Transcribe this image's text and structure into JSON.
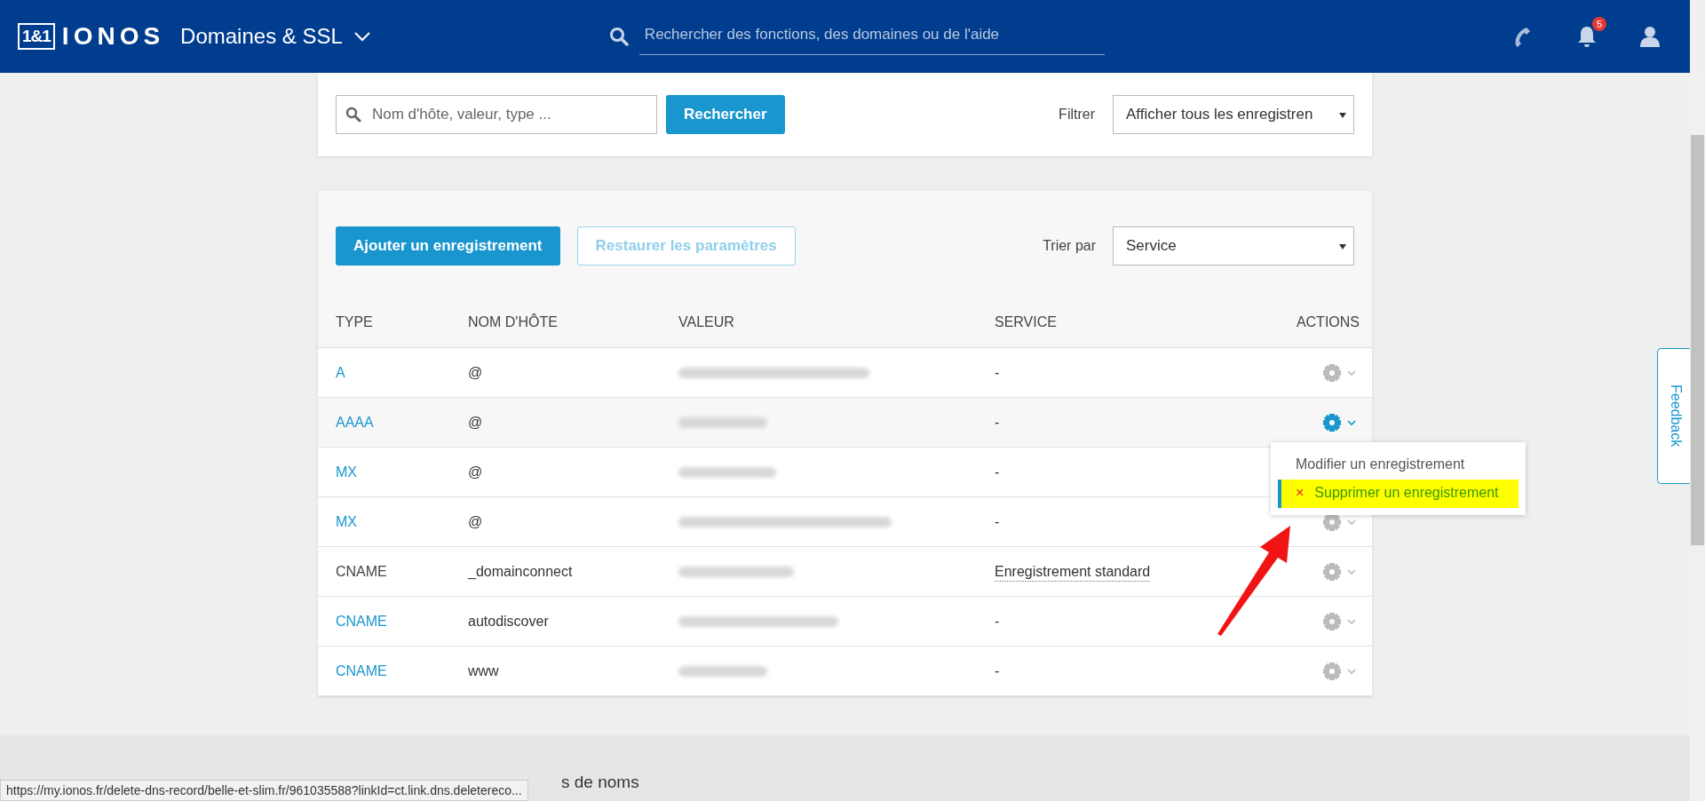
{
  "header": {
    "logo_box": "1&1",
    "logo_word": "IONOS",
    "section": "Domaines & SSL",
    "search": {
      "placeholder": "Rechercher des fonctions, des domaines ou de l'aide"
    },
    "notifications": "5"
  },
  "search_panel": {
    "search": {
      "placeholder": "Nom d'hôte, valeur, type ..."
    },
    "search_button": "Rechercher",
    "filter_label": "Filtrer",
    "filter_value": "Afficher tous les enregistren"
  },
  "records_panel": {
    "add_button": "Ajouter un enregistrement",
    "restore_button": "Restaurer les paramètres",
    "sort_label": "Trier par",
    "sort_value": "Service",
    "columns": [
      "TYPE",
      "NOM D'HÔTE",
      "VALEUR",
      "SERVICE",
      "ACTIONS"
    ],
    "rows": [
      {
        "type": "A",
        "link": true,
        "host": "@",
        "service": "-",
        "underlined": false,
        "active": false
      },
      {
        "type": "AAAA",
        "link": true,
        "host": "@",
        "service": "-",
        "underlined": false,
        "active": true
      },
      {
        "type": "MX",
        "link": true,
        "host": "@",
        "service": "-",
        "underlined": false,
        "active": false
      },
      {
        "type": "MX",
        "link": true,
        "host": "@",
        "service": "-",
        "underlined": false,
        "active": false
      },
      {
        "type": "CNAME",
        "link": false,
        "host": "_domainconnect",
        "service": "Enregistrement standard",
        "underlined": true,
        "active": false
      },
      {
        "type": "CNAME",
        "link": true,
        "host": "autodiscover",
        "service": "-",
        "underlined": false,
        "active": false
      },
      {
        "type": "CNAME",
        "link": true,
        "host": "www",
        "service": "-",
        "underlined": false,
        "active": false
      }
    ],
    "menu": [
      {
        "label": "Modifier un enregistrement",
        "kind": "edit",
        "highlighted": false
      },
      {
        "label": "Supprimer un enregistrement",
        "kind": "delete",
        "icon": "×",
        "highlighted": true
      }
    ]
  },
  "feedback": "Feedback",
  "footer_heading": "s de noms",
  "status_url": "https://my.ionos.fr/delete-dns-record/belle-et-slim.fr/961035588?linkId=ct.link.dns.deletereco..."
}
